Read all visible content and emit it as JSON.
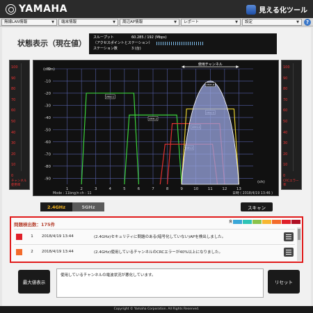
{
  "header": {
    "brand": "YAMAHA",
    "app_title": "見える化ツール"
  },
  "nav": {
    "tabs": [
      {
        "label": "無線LAN情報"
      },
      {
        "label": "端末情報"
      },
      {
        "label": "周辺AP情報"
      },
      {
        "label": "レポート"
      },
      {
        "label": "設定"
      }
    ],
    "help": "?"
  },
  "page": {
    "title": "状態表示（現在値）"
  },
  "info": {
    "throughput_label": "スループット",
    "throughput_value": "60.285 / 192 (Mbps)",
    "access_point_label": "（アクセスポイントとステーション）",
    "stations_label": "ステーション数",
    "stations_value": "3 (台)"
  },
  "gauges": {
    "left": {
      "ticks": [
        "100",
        "90",
        "80",
        "70",
        "60",
        "50",
        "40",
        "30",
        "20",
        "10",
        "0"
      ],
      "caption": "チャンネル使用率"
    },
    "right": {
      "ticks": [
        "100",
        "90",
        "80",
        "70",
        "60",
        "50",
        "40",
        "30",
        "20",
        "10",
        "0"
      ],
      "caption": "CRCエラー率"
    }
  },
  "chart_data": {
    "type": "area",
    "ylabel": "(dBm)",
    "xlabel": "(ch)",
    "y_ticks": [
      0,
      -10,
      -20,
      -30,
      -40,
      -50,
      -60,
      -70,
      -80,
      -90
    ],
    "ylim": [
      -95,
      0
    ],
    "x_ticks": [
      1,
      2,
      3,
      4,
      5,
      6,
      7,
      8,
      9,
      10,
      11,
      12,
      13
    ],
    "xlim": [
      0,
      14
    ],
    "grid": true,
    "in_use_label": "使用チャンネル",
    "in_use_range": [
      9,
      13
    ],
    "footer_mode": "Mode : 11bng/n  ch : 11",
    "footer_date": "日時 ( 2018/4/19 13:46 )",
    "series": [
      {
        "name": "VMH-1",
        "center": 4,
        "left": 2,
        "right": 6,
        "top": -20,
        "color": "#3bd23b"
      },
      {
        "name": "VMH-2",
        "center": 7,
        "left": 5,
        "right": 9,
        "top": -38,
        "color": "#3bd23b"
      },
      {
        "name": "VMH-3",
        "center": 9.5,
        "left": 7.5,
        "right": 11.5,
        "top": -62,
        "color": "#e23030"
      },
      {
        "name": "VMH-4",
        "center": 10,
        "left": 8,
        "right": 12,
        "top": -45,
        "color": "#e23030"
      },
      {
        "name": "VMH-5",
        "center": 11,
        "left": 9,
        "right": 13,
        "top": -33,
        "color": "#e8d030"
      },
      {
        "name": "VMH-6",
        "center": 11,
        "left": 9,
        "right": 13,
        "top": -10,
        "color": "#9aa6e0",
        "filled": true
      }
    ]
  },
  "band_tabs": {
    "band_24": "2.4GHz",
    "band_5": "5GHz"
  },
  "scan_button": "スキャン",
  "events": {
    "count_label": "問題検出数：175件",
    "legend_label": "良",
    "legend_colors": [
      "#3aa7d8",
      "#2ec4b6",
      "#8bc34a",
      "#f7b731",
      "#f36b2b",
      "#e0202a",
      "#b01025"
    ],
    "rows": [
      {
        "num": "1",
        "time": "2018/4/19 13:44",
        "message": "(2.4GHz)セキュリティに問題のある(暗号化していない)APを検出しました。",
        "color": "#e0202a"
      },
      {
        "num": "2",
        "time": "2018/4/19 13:44",
        "message": "(2.4GHz)使用しているチャンネルのCRCエラーが40%以上になりました。",
        "color": "#f36b2b"
      }
    ]
  },
  "bottom": {
    "max_button": "最大値表示",
    "message": "使用しているチャンネルの電波状況が悪化しています。",
    "reset_button": "リセット"
  },
  "footer": {
    "copyright": "Copyright © Yamaha Corporation. All Rights Reserved."
  }
}
